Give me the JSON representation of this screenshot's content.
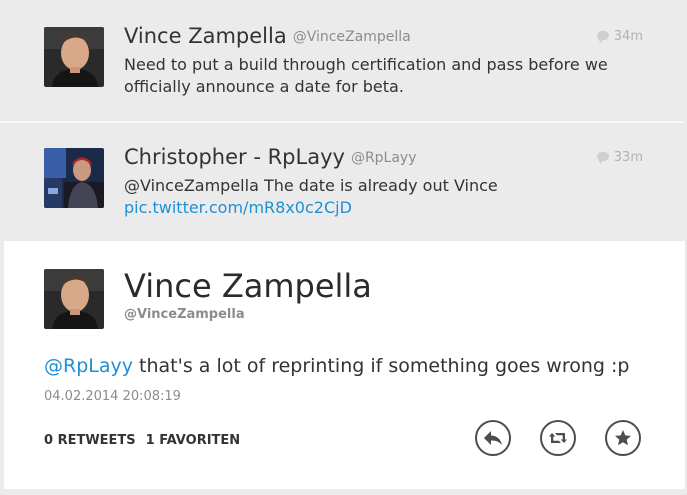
{
  "tweets": [
    {
      "name": "Vince Zampella",
      "handle": "@VinceZampella",
      "time": "34m",
      "text": "Need to put a build through certification and pass before we officially announce a date for beta."
    },
    {
      "name": "Christopher - RpLayy",
      "handle": "@RpLayy",
      "time": "33m",
      "text": "@VinceZampella The date is already out Vince",
      "link": "pic.twitter.com/mR8x0c2CjD"
    }
  ],
  "detail": {
    "name": "Vince Zampella",
    "handle": "@VinceZampella",
    "mention": "@RpLayy",
    "text": " that's a lot of reprinting if something goes wrong :p",
    "timestamp": "04.02.2014 20:08:19",
    "retweets": "0 RETWEETS",
    "favorites": "1 FAVORITEN"
  },
  "icons": {
    "reply": "reply-icon",
    "retweet": "retweet-icon",
    "favorite": "star-icon",
    "time": "speech-bubble-icon"
  },
  "colors": {
    "link": "#1f8fd6",
    "background": "#ebebeb",
    "detail_background": "#ffffff"
  }
}
